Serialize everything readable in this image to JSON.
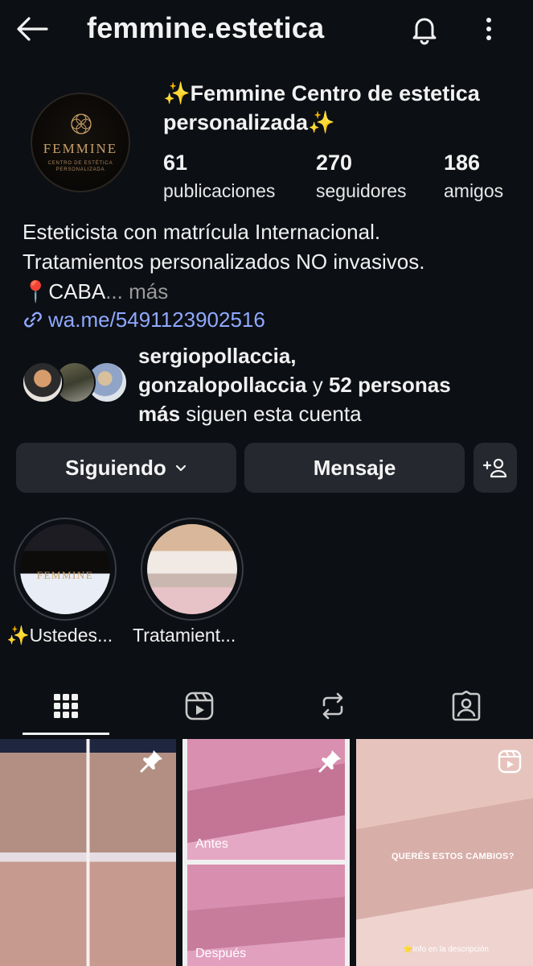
{
  "topbar": {
    "title": "femmine.estetica",
    "back_icon": "arrow-left-icon",
    "bell_icon": "bell-icon",
    "more_icon": "more-vertical-icon"
  },
  "profile": {
    "avatar_brand": "FEMMINE",
    "avatar_sub": "CENTRO DE ESTÉTICA PERSONALIZADA",
    "display_name": "✨Femmine Centro de estetica personalizada✨",
    "stats": {
      "posts_count": "61",
      "posts_label": "publicaciones",
      "followers_count": "270",
      "followers_label": "seguidores",
      "friends_count": "186",
      "friends_label": "amigos"
    },
    "bio_line1": "Esteticista con matrícula  Internacional.",
    "bio_line2": "Tratamientos personalizados NO invasivos.",
    "bio_line3": "📍CABA",
    "bio_more": "... más",
    "link": "wa.me/5491123902516"
  },
  "mutual": {
    "user1": "sergiopollaccia,",
    "user2": "gonzalopollaccia",
    "connector": " y ",
    "count": "52 personas",
    "more_word": "más",
    "suffix": " siguen esta cuenta"
  },
  "actions": {
    "following_label": "Siguiendo",
    "message_label": "Mensaje"
  },
  "highlights": [
    {
      "label": "✨Ustedes...",
      "brand": "FEMMINE"
    },
    {
      "label": "Tratamient..."
    }
  ],
  "grid": {
    "post2_before": "Antes",
    "post2_after": "Después",
    "post3_caption": "QUERÉS ESTOS CAMBIOS?",
    "post3_note": "⭐Info en la descripción"
  },
  "colors": {
    "background": "#0c0f14",
    "button": "#25282e",
    "link": "#8fa9ff"
  }
}
